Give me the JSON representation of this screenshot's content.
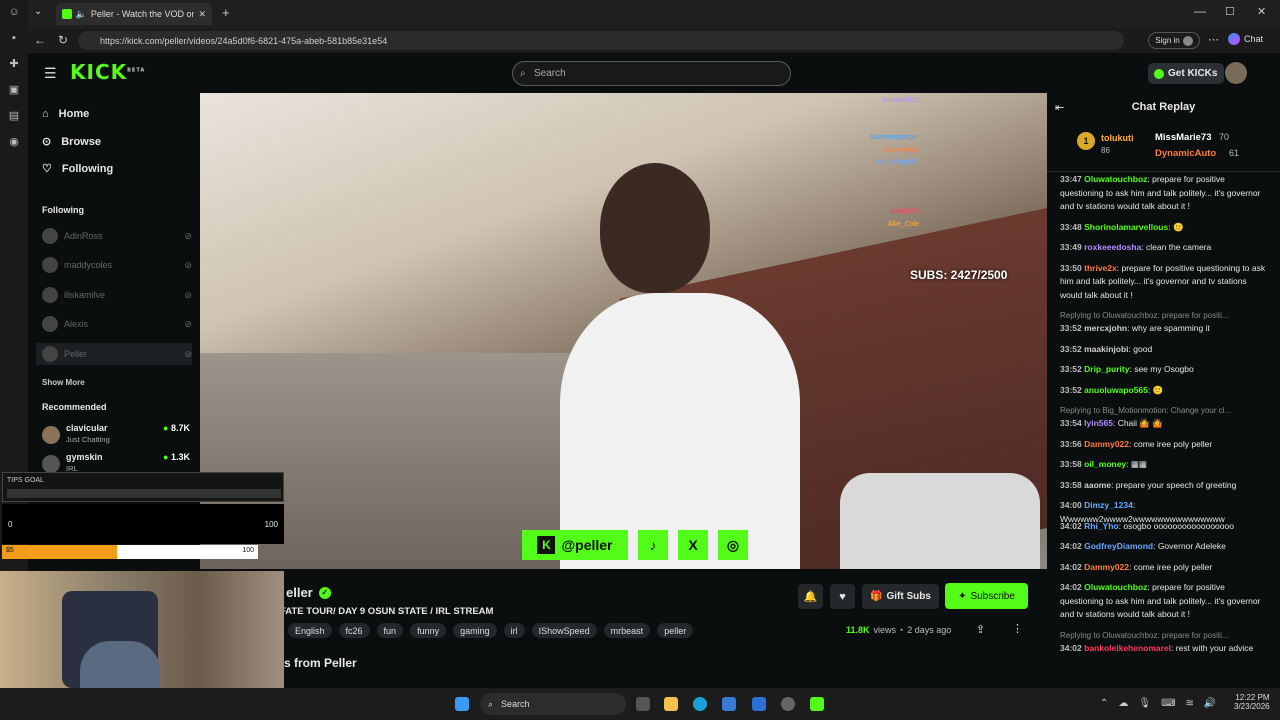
{
  "browser": {
    "tab_title": "Peller - Watch the VOD on Ki",
    "url": "https://kick.com/peller/videos/24a5d0f6-6821-475a-abeb-581b85e31e54",
    "sign_in": "Sign in",
    "chat_label": "Chat"
  },
  "header": {
    "logo": "KICK",
    "logo_beta": "BETA",
    "search_placeholder": "Search",
    "get_kicks": "Get KICKs"
  },
  "sidebar": {
    "nav": [
      {
        "label": "Home",
        "icon": "home-icon"
      },
      {
        "label": "Browse",
        "icon": "browse-icon"
      },
      {
        "label": "Following",
        "icon": "heart-icon"
      }
    ],
    "following_title": "Following",
    "following": [
      "AdinRoss",
      "maddycoles",
      "iliskamilve",
      "Alexis",
      "Peller"
    ],
    "show_more": "Show More",
    "recommended_title": "Recommended",
    "recommended": [
      {
        "name": "clavicular",
        "category": "Just Chatting",
        "viewers": "8.7K"
      },
      {
        "name": "gymskin",
        "category": "IRL",
        "viewers": "1.3K"
      }
    ]
  },
  "video": {
    "subs_text": "SUBS: 2427/2500",
    "social": [
      "@peller",
      "♪",
      "X",
      "◎"
    ],
    "overlay_names": [
      "Amarachi12",
      "Samsonprosper",
      "Dammy022",
      "Kubablog001",
      "benjo223",
      "Allie_Cole"
    ]
  },
  "stream": {
    "name": "eller",
    "title": "FATE TOUR/ DAY 9 OSUN STATE / IRL STREAM",
    "tags": [
      "English",
      "fc26",
      "fun",
      "funny",
      "gaming",
      "irl",
      "IShowSpeed",
      "mrbeast",
      "peller"
    ],
    "views": "11.8K",
    "views_label": "views",
    "time_ago": "2 days ago",
    "gift_subs": "Gift Subs",
    "subscribe": "Subscribe",
    "more_from": "s from Peller"
  },
  "chat": {
    "title": "Chat Replay",
    "leaders": [
      {
        "rank": "1",
        "name": "tolukuti",
        "score": "86"
      },
      {
        "name": "MissMarie73",
        "score": "70"
      },
      {
        "name": "DynamicAuto",
        "score": "61"
      }
    ],
    "messages": [
      {
        "time": "33:47",
        "user": "Oluwatouchboz",
        "color": "#53fc18",
        "text": "prepare for positive questioning to ask him and talk politely... it's governor and tv stations would talk about it !"
      },
      {
        "time": "33:48",
        "user": "Shorinolamarvellous",
        "color": "#53fc18",
        "text": "🙂"
      },
      {
        "time": "33:49",
        "user": "roxkeeedosha",
        "color": "#b08cff",
        "text": "clean the camera"
      },
      {
        "time": "33:50",
        "user": "thrive2x",
        "color": "#ff7b3a",
        "text": "prepare for positive questioning to ask him and talk politely... it's governor and tv stations would talk about it !"
      },
      {
        "reply": "Replying to Oluwatouchboz: prepare for positi..."
      },
      {
        "time": "33:52",
        "user": "mercxjohn",
        "color": "#d0d0d0",
        "text": "why are spamming it"
      },
      {
        "time": "33:52",
        "user": "maakinjobi",
        "color": "#d0d0d0",
        "text": "good"
      },
      {
        "time": "33:52",
        "user": "Drip_purity",
        "color": "#53fc18",
        "text": "see my Osogbo"
      },
      {
        "time": "33:52",
        "user": "anuoluwapo565",
        "color": "#53fc18",
        "text": "🙂"
      },
      {
        "reply": "Replying to Big_Motionmotion: Change your cl..."
      },
      {
        "time": "33:54",
        "user": "Iyin565",
        "color": "#b08cff",
        "text": "Chaii 🤷 🤷"
      },
      {
        "time": "33:56",
        "user": "Dammy022",
        "color": "#ff7b3a",
        "text": "come iree poly peller"
      },
      {
        "time": "33:58",
        "user": "oil_money",
        "color": "#53fc18",
        "text": "▦▦"
      },
      {
        "time": "33:58",
        "user": "aaome",
        "color": "#d0d0d0",
        "text": "prepare your speech of greeting"
      },
      {
        "time": "34:00",
        "user": "Dimzy_1234",
        "color": "#6aa8ff",
        "text": "Wwwwww2wwww2wwwwwwwwwwwwwww"
      },
      {
        "time": "34:02",
        "user": "Rhi_Yho",
        "color": "#6aa8ff",
        "text": "osogbo ooooooooooooooooo"
      },
      {
        "time": "34:02",
        "user": "GodfreyDiamond",
        "color": "#6aa8ff",
        "text": "Governor Adeleke"
      },
      {
        "time": "34:02",
        "user": "Dammy022",
        "color": "#ff7b3a",
        "text": "come iree poly peller"
      },
      {
        "time": "34:02",
        "user": "Oluwatouchboz",
        "color": "#53fc18",
        "text": "prepare for positive questioning to ask him and talk politely... it's governor and tv stations would talk about it !"
      },
      {
        "reply": "Replying to Oluwatouchboz: prepare for positi..."
      },
      {
        "time": "34:02",
        "user": "bankoleikehenomarel",
        "color": "#ff3a5a",
        "text": "rest with your advice"
      }
    ]
  },
  "widget": {
    "tips_goal": "TIPS GOAL",
    "min": "0",
    "max": "100",
    "bar_left": "$5",
    "bar_right": "100"
  },
  "taskbar": {
    "search": "Search",
    "time": "12:22 PM",
    "date": "3/23/2026"
  },
  "colors": {
    "accent": "#53fc18",
    "bg": "#0b0e0f"
  }
}
